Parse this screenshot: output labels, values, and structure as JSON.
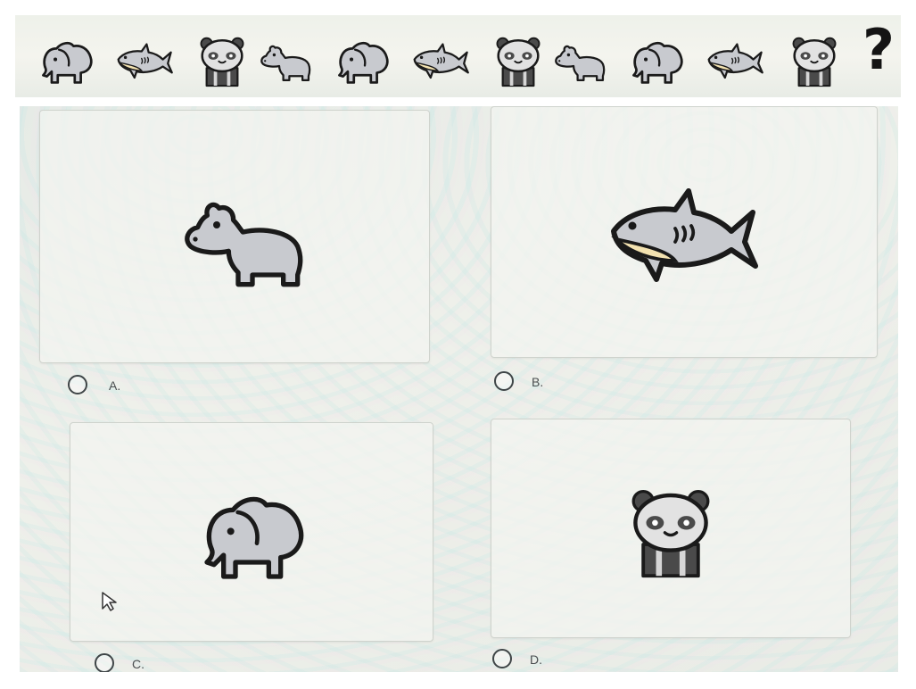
{
  "sequence": {
    "items": [
      "elephant-icon",
      "shark-icon",
      "panda-icon",
      "hippo-icon",
      "elephant-icon",
      "shark-icon",
      "panda-icon",
      "hippo-icon",
      "elephant-icon",
      "shark-icon",
      "panda-icon"
    ],
    "question_mark": "?"
  },
  "options": [
    {
      "label": "A.",
      "animal": "hippo-icon"
    },
    {
      "label": "B.",
      "animal": "shark-icon"
    },
    {
      "label": "C.",
      "animal": "elephant-icon"
    },
    {
      "label": "D.",
      "animal": "panda-icon"
    }
  ],
  "colors": {
    "outline": "#1a1a1a",
    "body_gray": "#c8cacf",
    "shark_belly": "#f3e2b0",
    "panda_dark": "#4a4a4a"
  }
}
